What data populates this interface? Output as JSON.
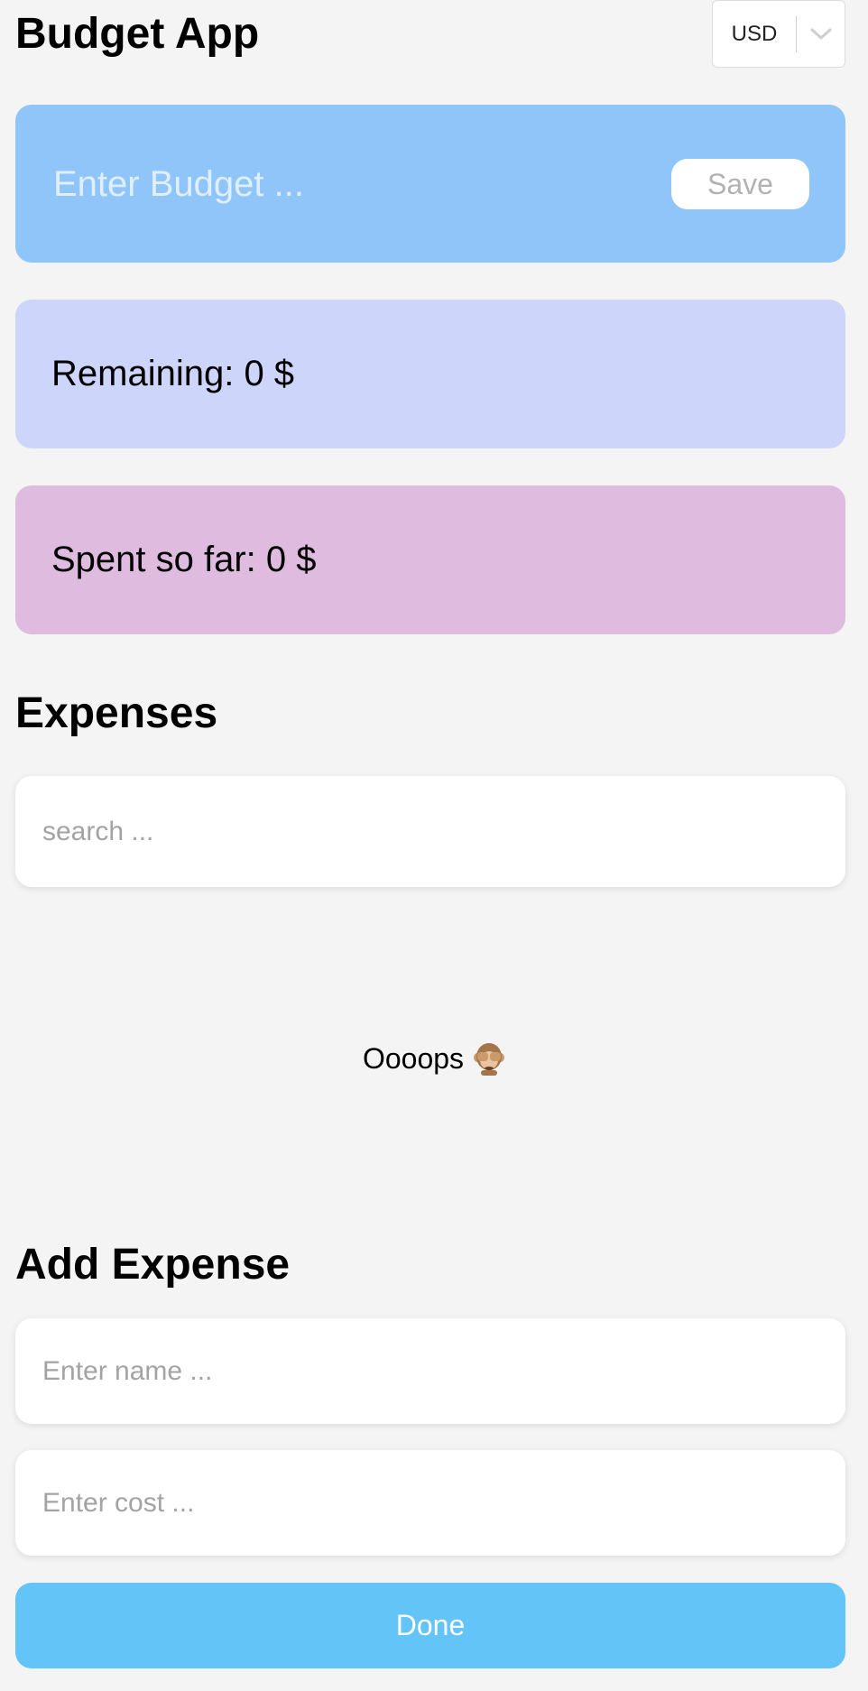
{
  "app": {
    "title": "Budget App",
    "currency": "USD"
  },
  "budget": {
    "placeholder": "Enter Budget ...",
    "save_label": "Save",
    "card_color": "#8fc5f9"
  },
  "summary": {
    "remaining_label": "Remaining: 0 $",
    "remaining_color": "#ced5fb",
    "spent_label": "Spent so far: 0 $",
    "spent_color": "#e0bbe0"
  },
  "expenses": {
    "heading": "Expenses",
    "search_placeholder": "search ...",
    "empty_text": "Oooops",
    "empty_icon": "see-no-evil-monkey-icon"
  },
  "add_expense": {
    "heading": "Add Expense",
    "name_placeholder": "Enter name ...",
    "cost_placeholder": "Enter cost ...",
    "done_label": "Done",
    "done_color": "#63c4f8"
  }
}
